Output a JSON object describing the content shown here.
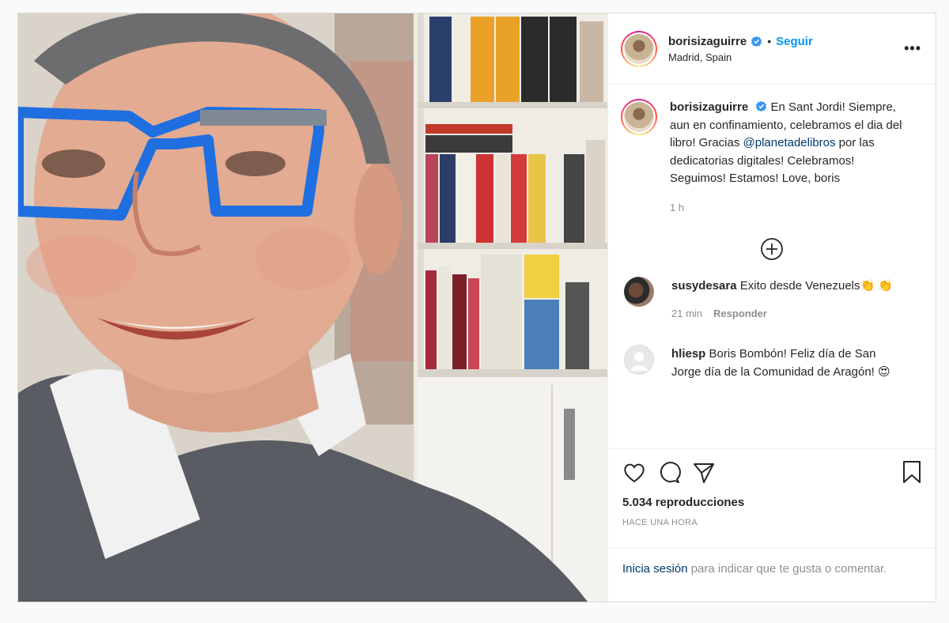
{
  "header": {
    "username": "borisizaguirre",
    "separator": "•",
    "follow_label": "Seguir",
    "location": "Madrid, Spain",
    "more_label": "•••"
  },
  "caption": {
    "username": "borisizaguirre",
    "text_before": " En Sant Jordi! Siempre, aun en confinamiento, celebramos el dia del libro! Gracias ",
    "mention": "@planetadelibros",
    "text_after": " por las dedicatorias digitales! Celebramos! Seguimos! Estamos! Love, boris",
    "time": "1 h"
  },
  "comments": [
    {
      "username": "susydesara",
      "text": "Exito desde Venezuels👏 👏",
      "time": "21 min",
      "reply_label": "Responder"
    },
    {
      "username": "hliesp",
      "text": "Boris Bombón! Feliz día de San Jorge día de la Comunidad de Aragón! 😍",
      "time": "",
      "reply_label": ""
    }
  ],
  "stats": {
    "views": "5.034 reproducciones",
    "posted": "HACE UNA HORA"
  },
  "login": {
    "link": "Inicia sesión",
    "rest": " para indicar que te gusta o comentar."
  },
  "icons": {
    "verified": "verified-badge-icon",
    "more": "more-options-icon",
    "load_more": "plus-circle-icon",
    "like": "heart-icon",
    "comment": "comment-bubble-icon",
    "share": "paper-plane-icon",
    "save": "bookmark-icon"
  },
  "colors": {
    "accent": "#0095f6",
    "mention": "#00376b",
    "muted": "#8e8e8e",
    "verified": "#3897f0"
  }
}
